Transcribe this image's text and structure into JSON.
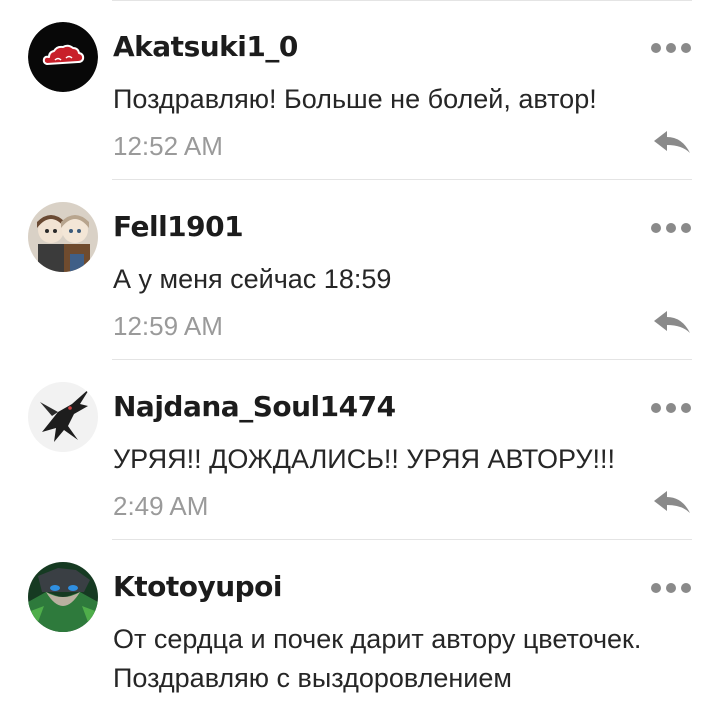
{
  "comments": [
    {
      "username": "Akatsuki1_0",
      "text": "Поздравляю! Больше не болей, автор!",
      "time": "12:52 AM",
      "avatar_icon": "akatsuki-cloud-avatar"
    },
    {
      "username": "Fell1901",
      "text": "А у меня сейчас 18:59",
      "time": "12:59 AM",
      "avatar_icon": "two-characters-avatar"
    },
    {
      "username": "Najdana_Soul1474",
      "text": "УРЯЯ!! ДОЖДАЛИСЬ!! УРЯЯ АВТОРУ!!!",
      "time": "2:49 AM",
      "avatar_icon": "dragon-avatar"
    },
    {
      "username": "Ktotoyupoi",
      "text": "От сердца и почек дарит автору цветочек. Поздравляю с выздоровлением",
      "time": "",
      "avatar_icon": "green-character-avatar"
    }
  ],
  "colors": {
    "username": "#1c1c1c",
    "text": "#262626",
    "timestamp": "#9a9a9a",
    "icon": "#8a8a8a",
    "divider": "#e4e4e4"
  }
}
